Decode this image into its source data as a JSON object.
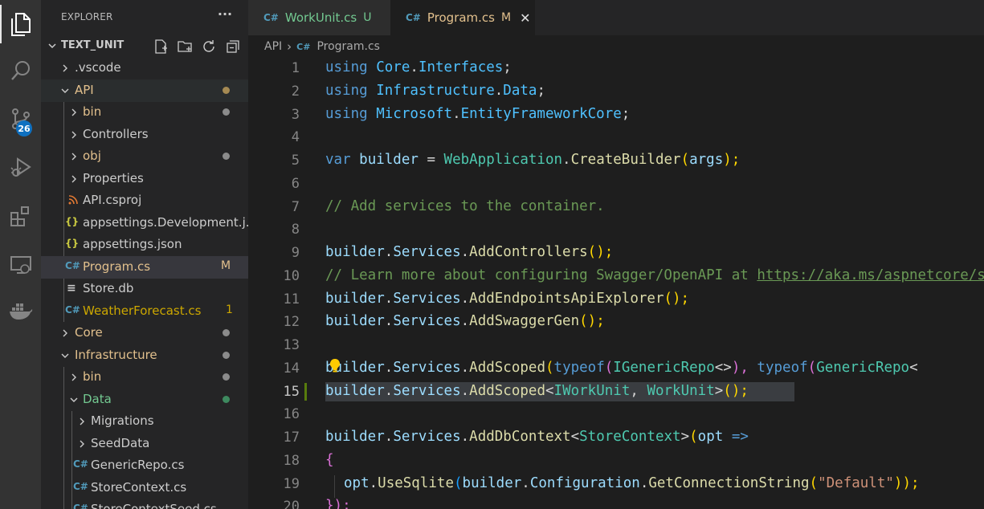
{
  "explorer": {
    "title": "EXPLORER",
    "more": "···",
    "workspace": "TEXT_UNIT"
  },
  "activity": {
    "source_control_badge": "26"
  },
  "tree": [
    {
      "label": ".vscode",
      "kind": "folder"
    },
    {
      "label": "API",
      "kind": "folder-open",
      "status": "dot"
    },
    {
      "label": "bin",
      "kind": "folder",
      "status": "dot"
    },
    {
      "label": "Controllers",
      "kind": "folder"
    },
    {
      "label": "obj",
      "kind": "folder",
      "status": "dot"
    },
    {
      "label": "Properties",
      "kind": "folder"
    },
    {
      "label": "API.csproj",
      "kind": "rss"
    },
    {
      "label": "appsettings.Development.j...",
      "kind": "json"
    },
    {
      "label": "appsettings.json",
      "kind": "json"
    },
    {
      "label": "Program.cs",
      "kind": "cs",
      "status": "M"
    },
    {
      "label": "Store.db",
      "kind": "db"
    },
    {
      "label": "WeatherForecast.cs",
      "kind": "cs",
      "status": "1"
    },
    {
      "label": "Core",
      "kind": "folder",
      "status": "dot"
    },
    {
      "label": "Infrastructure",
      "kind": "folder-open",
      "status": "dot"
    },
    {
      "label": "bin",
      "kind": "folder",
      "status": "dot"
    },
    {
      "label": "Data",
      "kind": "folder-open",
      "status": "dot"
    },
    {
      "label": "Migrations",
      "kind": "folder"
    },
    {
      "label": "SeedData",
      "kind": "folder"
    },
    {
      "label": "GenericRepo.cs",
      "kind": "cs"
    },
    {
      "label": "StoreContext.cs",
      "kind": "cs"
    },
    {
      "label": "StoreContextSeed.cs",
      "kind": "cs"
    }
  ],
  "tabs": [
    {
      "label": "WorkUnit.cs",
      "badge": "U",
      "icon": "C#"
    },
    {
      "label": "Program.cs",
      "badge": "M",
      "icon": "C#",
      "close": "✕"
    }
  ],
  "breadcrumb": {
    "folder": "API",
    "sep": "›",
    "file": "Program.cs",
    "icon": "C#"
  },
  "line_numbers": [
    "1",
    "2",
    "3",
    "4",
    "5",
    "6",
    "7",
    "8",
    "9",
    "10",
    "11",
    "12",
    "13",
    "14",
    "15",
    "16",
    "17",
    "18",
    "19",
    "20"
  ],
  "code": {
    "l1": [
      "using",
      " ",
      "Core",
      ".",
      "Interfaces",
      ";"
    ],
    "l2": [
      "using",
      " ",
      "Infrastructure",
      ".",
      "Data",
      ";"
    ],
    "l3": [
      "using",
      " ",
      "Microsoft",
      ".",
      "EntityFrameworkCore",
      ";"
    ],
    "l5": [
      "var",
      " ",
      "builder",
      " = ",
      "WebApplication",
      ".",
      "CreateBuilder",
      "(",
      "args",
      ");"
    ],
    "l7": "// Add services to the container.",
    "l9": [
      "builder",
      ".",
      "Services",
      ".",
      "AddControllers",
      "();"
    ],
    "l10": [
      "// Learn more about configuring Swagger/OpenAPI at ",
      "https://aka.ms/aspnetcore/swashbuckle"
    ],
    "l11": [
      "builder",
      ".",
      "Services",
      ".",
      "AddEndpointsApiExplorer",
      "();"
    ],
    "l12": [
      "builder",
      ".",
      "Services",
      ".",
      "AddSwaggerGen",
      "();"
    ],
    "l14": [
      "builder",
      ".",
      "Services",
      ".",
      "AddScoped",
      "(",
      "typeof",
      "(",
      "IGenericRepo",
      "<>",
      "), ",
      "typeof",
      "(",
      "GenericRepo",
      "<"
    ],
    "l15": [
      "builder",
      ".",
      "Services",
      ".",
      "AddScoped",
      "<",
      "IWorkUnit",
      ", ",
      "WorkUnit",
      ">",
      "();"
    ],
    "l17": [
      "builder",
      ".",
      "Services",
      ".",
      "AddDbContext",
      "<",
      "StoreContext",
      ">",
      "(",
      "opt",
      " =>"
    ],
    "l18": "{",
    "l19": [
      "opt",
      ".",
      "UseSqlite",
      "(",
      "builder",
      ".",
      "Configuration",
      ".",
      "GetConnectionString",
      "(",
      "\"Default\"",
      "));"
    ],
    "l20": "});"
  },
  "colors": {
    "activity_bar": "#333333",
    "sidebar": "#252526",
    "editor": "#1e1e1e",
    "modified": "#e2c08d",
    "untracked": "#73c991",
    "csharp_icon": "#519aba",
    "json_icon": "#cbcb41",
    "rss_icon": "#e37933"
  }
}
